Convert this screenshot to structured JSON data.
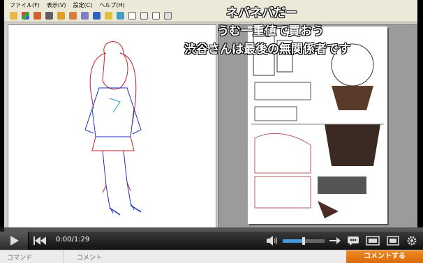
{
  "app": {
    "menu": [
      "ファイル(F)",
      "表示(V)",
      "設定(C)",
      "ヘルプ(H)"
    ],
    "toolbar_icons": [
      "open-folder-icon",
      "cube-3d-icon",
      "cut-icon",
      "print-icon",
      "layout-icon",
      "export-icon",
      "settings-icon",
      "blue-tool-icon",
      "help-icon",
      "view-icon",
      "page-icon",
      "grid-icon",
      "single-page-icon",
      "list-icon"
    ]
  },
  "overlay_comments": [
    "ネバネバだー",
    "うむ一重値で買おう",
    "渋谷さんは最後の無関係者です"
  ],
  "player": {
    "time": "0:00/1:29",
    "progress": 0.01,
    "volume": 0.5,
    "seek_color": "#1a1a1a",
    "accent": "#4a9bdc"
  },
  "comment_bar": {
    "command_label": "コマンド",
    "comment_label": "コメント",
    "post_button": "コメントする",
    "post_color": "#e87a17"
  }
}
